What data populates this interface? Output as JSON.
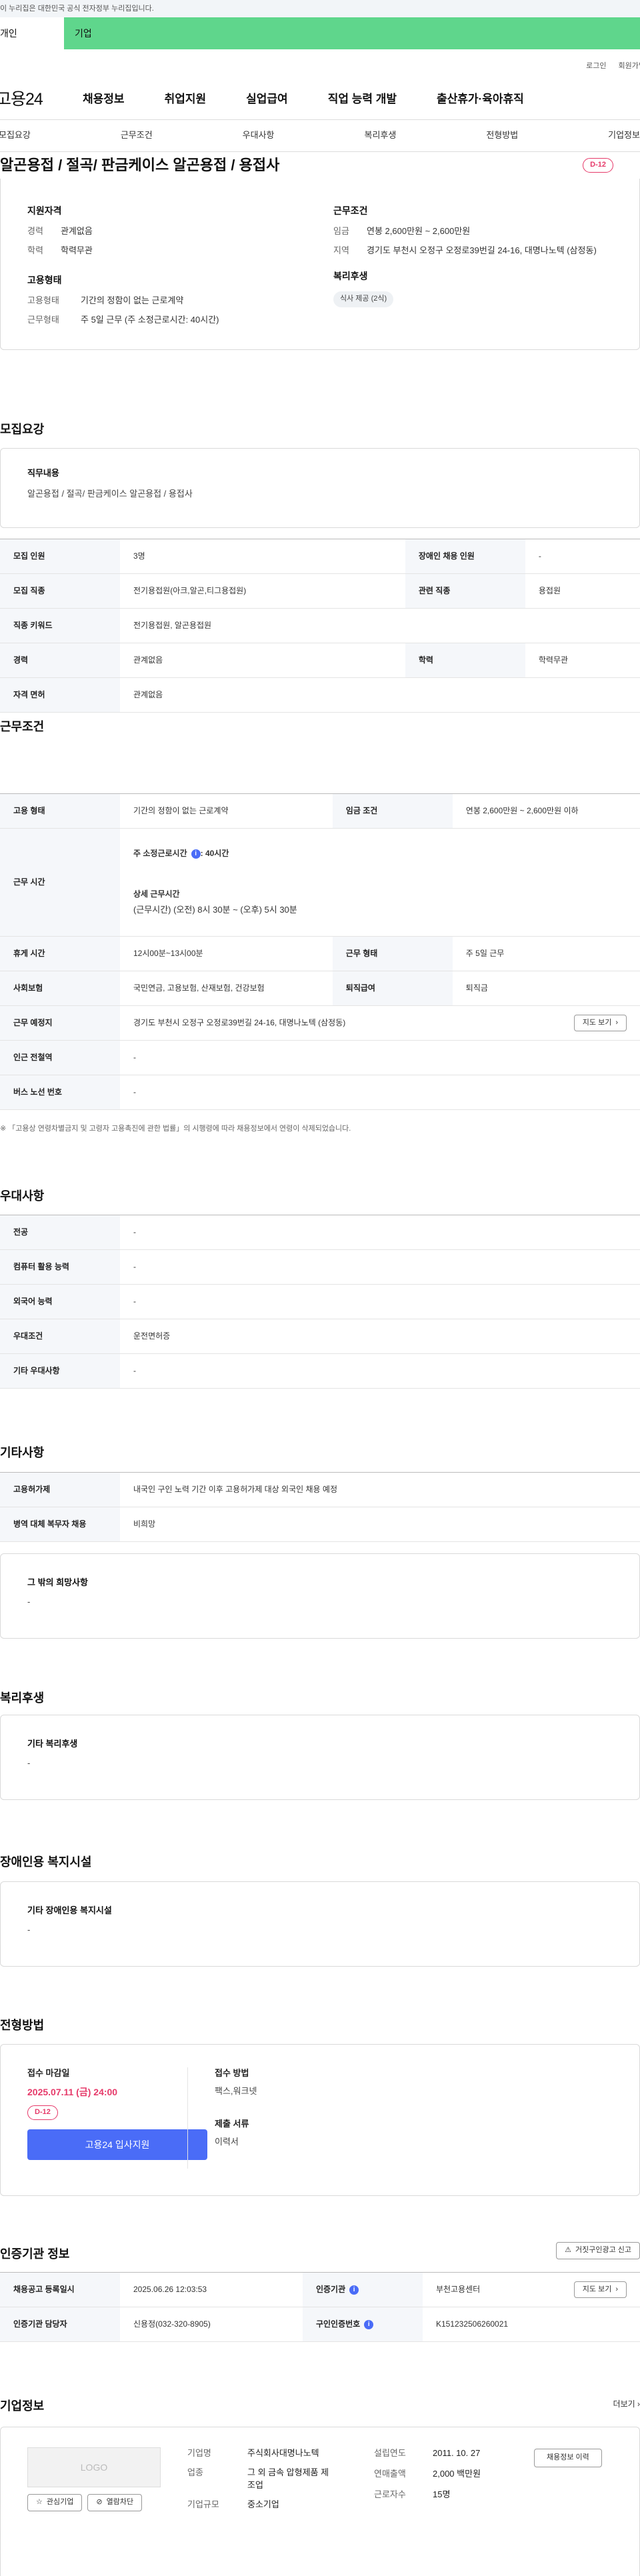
{
  "gov_banner": "이 누리집은 대한민국 공식 전자정부 누리집입니다.",
  "tabs": {
    "individual": "개인",
    "company": "기업"
  },
  "util": {
    "login": "로그인",
    "join": "회원가입"
  },
  "gnb": {
    "logo": "고용24",
    "menu": [
      "채용정보",
      "취업지원",
      "실업급여",
      "직업 능력 개발",
      "출산휴가·육아휴직"
    ]
  },
  "snb": [
    "모집요강",
    "근무조건",
    "우대사항",
    "복리후생",
    "전형방법",
    "기업정보"
  ],
  "summary": {
    "title": "알곤용접 / 절곡/ 판금케이스 알곤용접 / 용접사",
    "dday": "D-12",
    "qual": {
      "title": "지원자격",
      "rows": [
        {
          "k": "경력",
          "v": "관계없음"
        },
        {
          "k": "학력",
          "v": "학력무관"
        }
      ]
    },
    "cond": {
      "title": "근무조건",
      "rows": [
        {
          "k": "임금",
          "v": "연봉 2,600만원 ~ 2,600만원"
        },
        {
          "k": "지역",
          "v": "경기도 부천시 오정구 오정로39번길 24-16, 대명나노텍 (삼정동)"
        }
      ]
    },
    "emp": {
      "title": "고용형태",
      "rows": [
        {
          "k": "고용형태",
          "v": "기간의 정함이 없는 근로계약"
        },
        {
          "k": "근무형태",
          "v": "주 5일 근무 (주 소정근로시간: 40시간)"
        }
      ]
    },
    "welfare": {
      "title": "복리후생",
      "chip": "식사 제공 (2식)"
    }
  },
  "recruit": {
    "heading": "모집요강",
    "duty_title": "직무내용",
    "duty_text": "알곤용접 / 절곡/ 판금케이스 알곤용접 / 용접사",
    "rows": [
      {
        "k1": "모집 인원",
        "v1": "3명",
        "k2": "장애인 채용 인원",
        "v2": "-"
      },
      {
        "k1": "모집 직종",
        "v1": "전기용접원(아크,알곤,티그용접원)",
        "k2": "관련 직종",
        "v2": "용접원"
      },
      {
        "k1": "직종 키워드",
        "v1": "전기용접원, 알곤용접원"
      },
      {
        "k1": "경력",
        "v1": "관계없음",
        "k2": "학력",
        "v2": "학력무관"
      },
      {
        "k1": "자격 면허",
        "v1": "관계없음"
      }
    ]
  },
  "work": {
    "heading": "근무조건",
    "emp_type_k": "고용 형태",
    "emp_type_v": "기간의 정함이 없는 근로계약",
    "wage_k": "임금 조건",
    "wage_v": "연봉 2,600만원 ~ 2,600만원 이하",
    "hours_k": "근무 시간",
    "hours_week": "주 소정근로시간",
    "hours_week_val": ": 40시간",
    "hours_detail_title": "상세 근무시간",
    "hours_detail": "(근무시간) (오전) 8시 30분 ~ (오후) 5시 30분",
    "rest_k": "휴게 시간",
    "rest_v": "12시00분~13시00분",
    "form_k": "근무 형태",
    "form_v": "주 5일 근무",
    "ins_k": "사회보험",
    "ins_v": "국민연금, 고용보험, 산재보험, 건강보험",
    "sev_k": "퇴직급여",
    "sev_v": "퇴직금",
    "place_k": "근무 예정지",
    "place_v": "경기도 부천시 오정구 오정로39번길 24-16, 대명나노텍 (삼정동)",
    "map_btn": "지도 보기",
    "subway_k": "인근 전철역",
    "subway_v": "-",
    "bus_k": "버스 노선 번호",
    "bus_v": "-",
    "note": "「고용상 연령차별금지 및 고령자 고용촉진에 관한 법률」의 시행령에 따라 채용정보에서 연령이 삭제되었습니다."
  },
  "pref": {
    "heading": "우대사항",
    "rows": [
      {
        "k": "전공",
        "v": "-"
      },
      {
        "k": "컴퓨터 활용 능력",
        "v": "-"
      },
      {
        "k": "외국어 능력",
        "v": "-"
      },
      {
        "k": "우대조건",
        "v": "운전면허증"
      },
      {
        "k": "기타 우대사항",
        "v": "-"
      }
    ]
  },
  "etc": {
    "heading": "기타사항",
    "rows": [
      {
        "k": "고용허가제",
        "v": "내국인 구인 노력 기간 이후 고용허가제 대상 외국인 채용 예정"
      },
      {
        "k": "병역 대체 복무자 채용",
        "v": "비희망"
      }
    ],
    "box_title": "그 밖의 희망사항",
    "box_text": "-"
  },
  "benefit": {
    "heading": "복리후생",
    "box_title": "기타 복리후생",
    "box_text": "-"
  },
  "disabled": {
    "heading": "장애인용 복지시설",
    "box_title": "기타 장애인용 복지시설",
    "box_text": "-"
  },
  "process": {
    "heading": "전형방법",
    "deadline_title": "접수 마감일",
    "deadline": "2025.07.11 (금) 24:00",
    "dday": "D-12",
    "apply": "고용24 입사지원",
    "method_title": "접수 방법",
    "method": "팩스,워크넷",
    "docs_title": "제출 서류",
    "docs": "이력서"
  },
  "cert": {
    "heading": "인증기관 정보",
    "report_btn": "거짓구인광고 신고",
    "reg_k": "채용공고 등록일시",
    "reg_v": "2025.06.26 12:03:53",
    "agency_k": "인증기관",
    "agency_v": "부천고용센터",
    "map_btn": "지도 보기",
    "staff_k": "인증기관 담당자",
    "staff_v": "신용정(032-320-8905)",
    "num_k": "구인인증번호",
    "num_v": "K151232506260021"
  },
  "company": {
    "heading": "기업정보",
    "more": "더보기",
    "logo_text": "LOGO",
    "interest_btn": "관심기업",
    "block_btn": "열람차단",
    "name_k": "기업명",
    "name_v": "주식회사대명나노텍",
    "industry_k": "업종",
    "industry_v": "그 외 금속 압형제품 제조업",
    "size_k": "기업규모",
    "size_v": "중소기업",
    "est_k": "설립연도",
    "est_v": "2011. 10. 27",
    "sales_k": "연매출액",
    "sales_v": "2,000 백만원",
    "staff_k": "근로자수",
    "staff_v": "15명",
    "jobs_btn": "채용정보 이력"
  },
  "colors": {
    "accent": "#4a6cf7",
    "dday": "#e63a6a",
    "company_tab": "#5fd68c"
  }
}
